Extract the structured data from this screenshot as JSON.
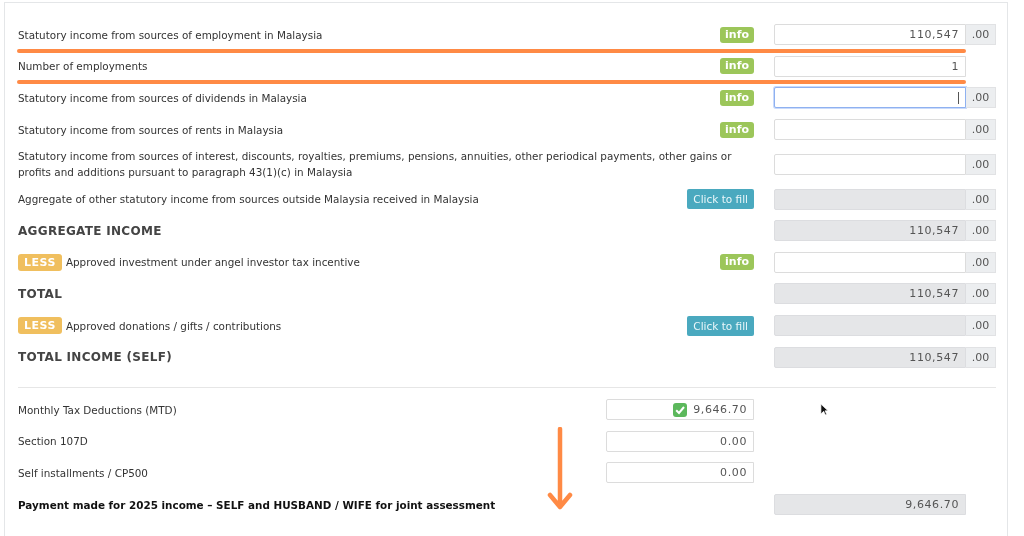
{
  "income_rows": [
    {
      "label": "Statutory income from sources of employment in Malaysia",
      "kind": "plain",
      "underlined": true,
      "action": {
        "kind": "info",
        "label": "info"
      },
      "field": {
        "value": "110,547",
        "readonly": false,
        "focused": false,
        "suffix": ".00"
      }
    },
    {
      "label": "Number of employments",
      "kind": "plain",
      "underlined": true,
      "action": {
        "kind": "info",
        "label": "info"
      },
      "field": {
        "value": "1",
        "readonly": false,
        "focused": false
      }
    },
    {
      "label": "Statutory income from sources of dividends in Malaysia",
      "kind": "plain",
      "underlined": false,
      "action": {
        "kind": "info",
        "label": "info"
      },
      "field": {
        "readonly": false,
        "focused": true,
        "suffix": ".00"
      }
    },
    {
      "label": "Statutory income from sources of rents in Malaysia",
      "kind": "plain",
      "underlined": false,
      "action": {
        "kind": "info",
        "label": "info"
      },
      "field": {
        "readonly": false,
        "focused": false,
        "suffix": ".00"
      }
    },
    {
      "label": "Statutory income from sources of interest, discounts, royalties, premiums, pensions, annuities, other periodical payments, other gains or profits and additions pursuant to paragraph 43(1)(c) in Malaysia",
      "kind": "plain",
      "underlined": false,
      "field": {
        "readonly": false,
        "focused": false,
        "suffix": ".00"
      }
    },
    {
      "label": "Aggregate of other statutory income from sources outside Malaysia received in Malaysia",
      "kind": "plain",
      "underlined": false,
      "action": {
        "kind": "fill",
        "label": "Click to fill"
      },
      "field": {
        "readonly": true,
        "focused": false,
        "suffix": ".00"
      }
    },
    {
      "label": "AGGREGATE INCOME",
      "kind": "heading",
      "underlined": false,
      "field": {
        "value": "110,547",
        "readonly": true,
        "focused": false,
        "suffix": ".00"
      }
    },
    {
      "label": "Approved investment under angel investor tax incentive",
      "kind": "plain",
      "tag": "LESS",
      "underlined": false,
      "action": {
        "kind": "info",
        "label": "info"
      },
      "field": {
        "readonly": false,
        "focused": false,
        "suffix": ".00"
      }
    },
    {
      "label": "TOTAL",
      "kind": "heading",
      "underlined": false,
      "field": {
        "value": "110,547",
        "readonly": true,
        "focused": false,
        "suffix": ".00"
      }
    },
    {
      "label": "Approved donations / gifts / contributions",
      "kind": "plain",
      "tag": "LESS",
      "underlined": false,
      "action": {
        "kind": "fill",
        "label": "Click to fill"
      },
      "field": {
        "readonly": true,
        "focused": false,
        "suffix": ".00"
      }
    },
    {
      "label": "TOTAL INCOME (SELF)",
      "kind": "heading",
      "underlined": false,
      "field": {
        "value": "110,547",
        "readonly": true,
        "focused": false,
        "suffix": ".00"
      }
    }
  ],
  "payments": [
    {
      "label": "Monthly Tax Deductions (MTD)",
      "verified": true,
      "value": "9,646.70"
    },
    {
      "label": "Section 107D",
      "verified": false,
      "value": "0.00"
    },
    {
      "label": "Self installments / CP500",
      "verified": false,
      "value": "0.00"
    }
  ],
  "payment_total": {
    "label": "Payment made for 2025 income – SELF and HUSBAND / WIFE for joint assessment",
    "value": "9,646.70"
  }
}
